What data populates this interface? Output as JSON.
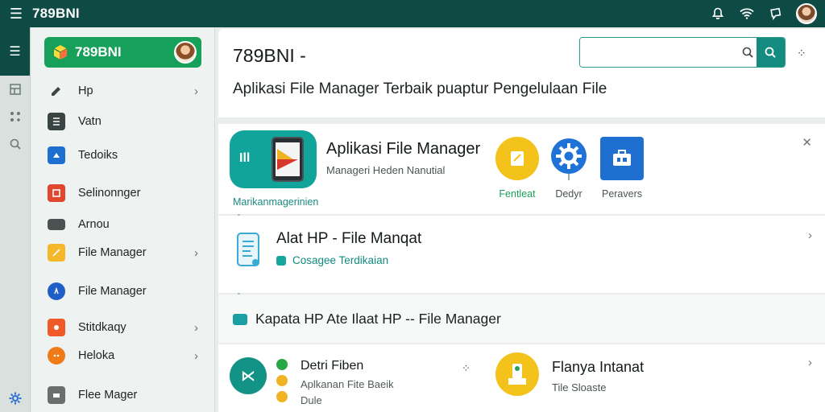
{
  "appbar": {
    "title": "789BNI"
  },
  "sidebar": {
    "brand": "789BNI",
    "items": [
      {
        "label": "Hp",
        "chevron": true
      },
      {
        "label": "Vatn",
        "chevron": false
      },
      {
        "label": "Tedoiks",
        "chevron": false
      },
      {
        "label": "Selinonnger",
        "chevron": false
      },
      {
        "label": "Arnou",
        "chevron": false
      },
      {
        "label": "File Manager",
        "chevron": true
      },
      {
        "label": "File Manager",
        "chevron": false
      },
      {
        "label": "Stitdkaqy",
        "chevron": true
      },
      {
        "label": "Heloka",
        "chevron": true
      },
      {
        "label": "Flee Mager",
        "chevron": false
      }
    ]
  },
  "header": {
    "title": "789BNI -",
    "subtitle": "Aplikasi File Manager Terbaik puaptur Pengelulaan File",
    "search_placeholder": ""
  },
  "card1": {
    "caption": "Marikanmagerinien",
    "title": "Aplikasi File Manager",
    "subtitle": "Manageri Heden Nanutial",
    "apps": [
      {
        "label": "Fentleat",
        "color": "#f3c21b",
        "label_color": "#17a05a"
      },
      {
        "label": "Dedyr",
        "color": "#1f73d6",
        "label_color": "#4a5452"
      },
      {
        "label": "Peravers",
        "color": "#1f6fd1",
        "label_color": "#4a5452"
      }
    ]
  },
  "card2": {
    "title": "Alat HP - File Manqat",
    "subtitle": "Cosagee Terdikaian"
  },
  "card3": {
    "line": "Kapata HP   Ate Ilaat HP -- File Manager"
  },
  "card4": {
    "title": "Detri Fiben",
    "line1": "Aplkanan Fite Baeik",
    "line2": "Dule",
    "dots": "⁘",
    "right_title": "Flanya Intanat",
    "right_sub": "Tile Sloaste"
  },
  "colors": {
    "appbar": "#0f4b45",
    "brand": "#17a05a",
    "accent": "#138b7f"
  }
}
